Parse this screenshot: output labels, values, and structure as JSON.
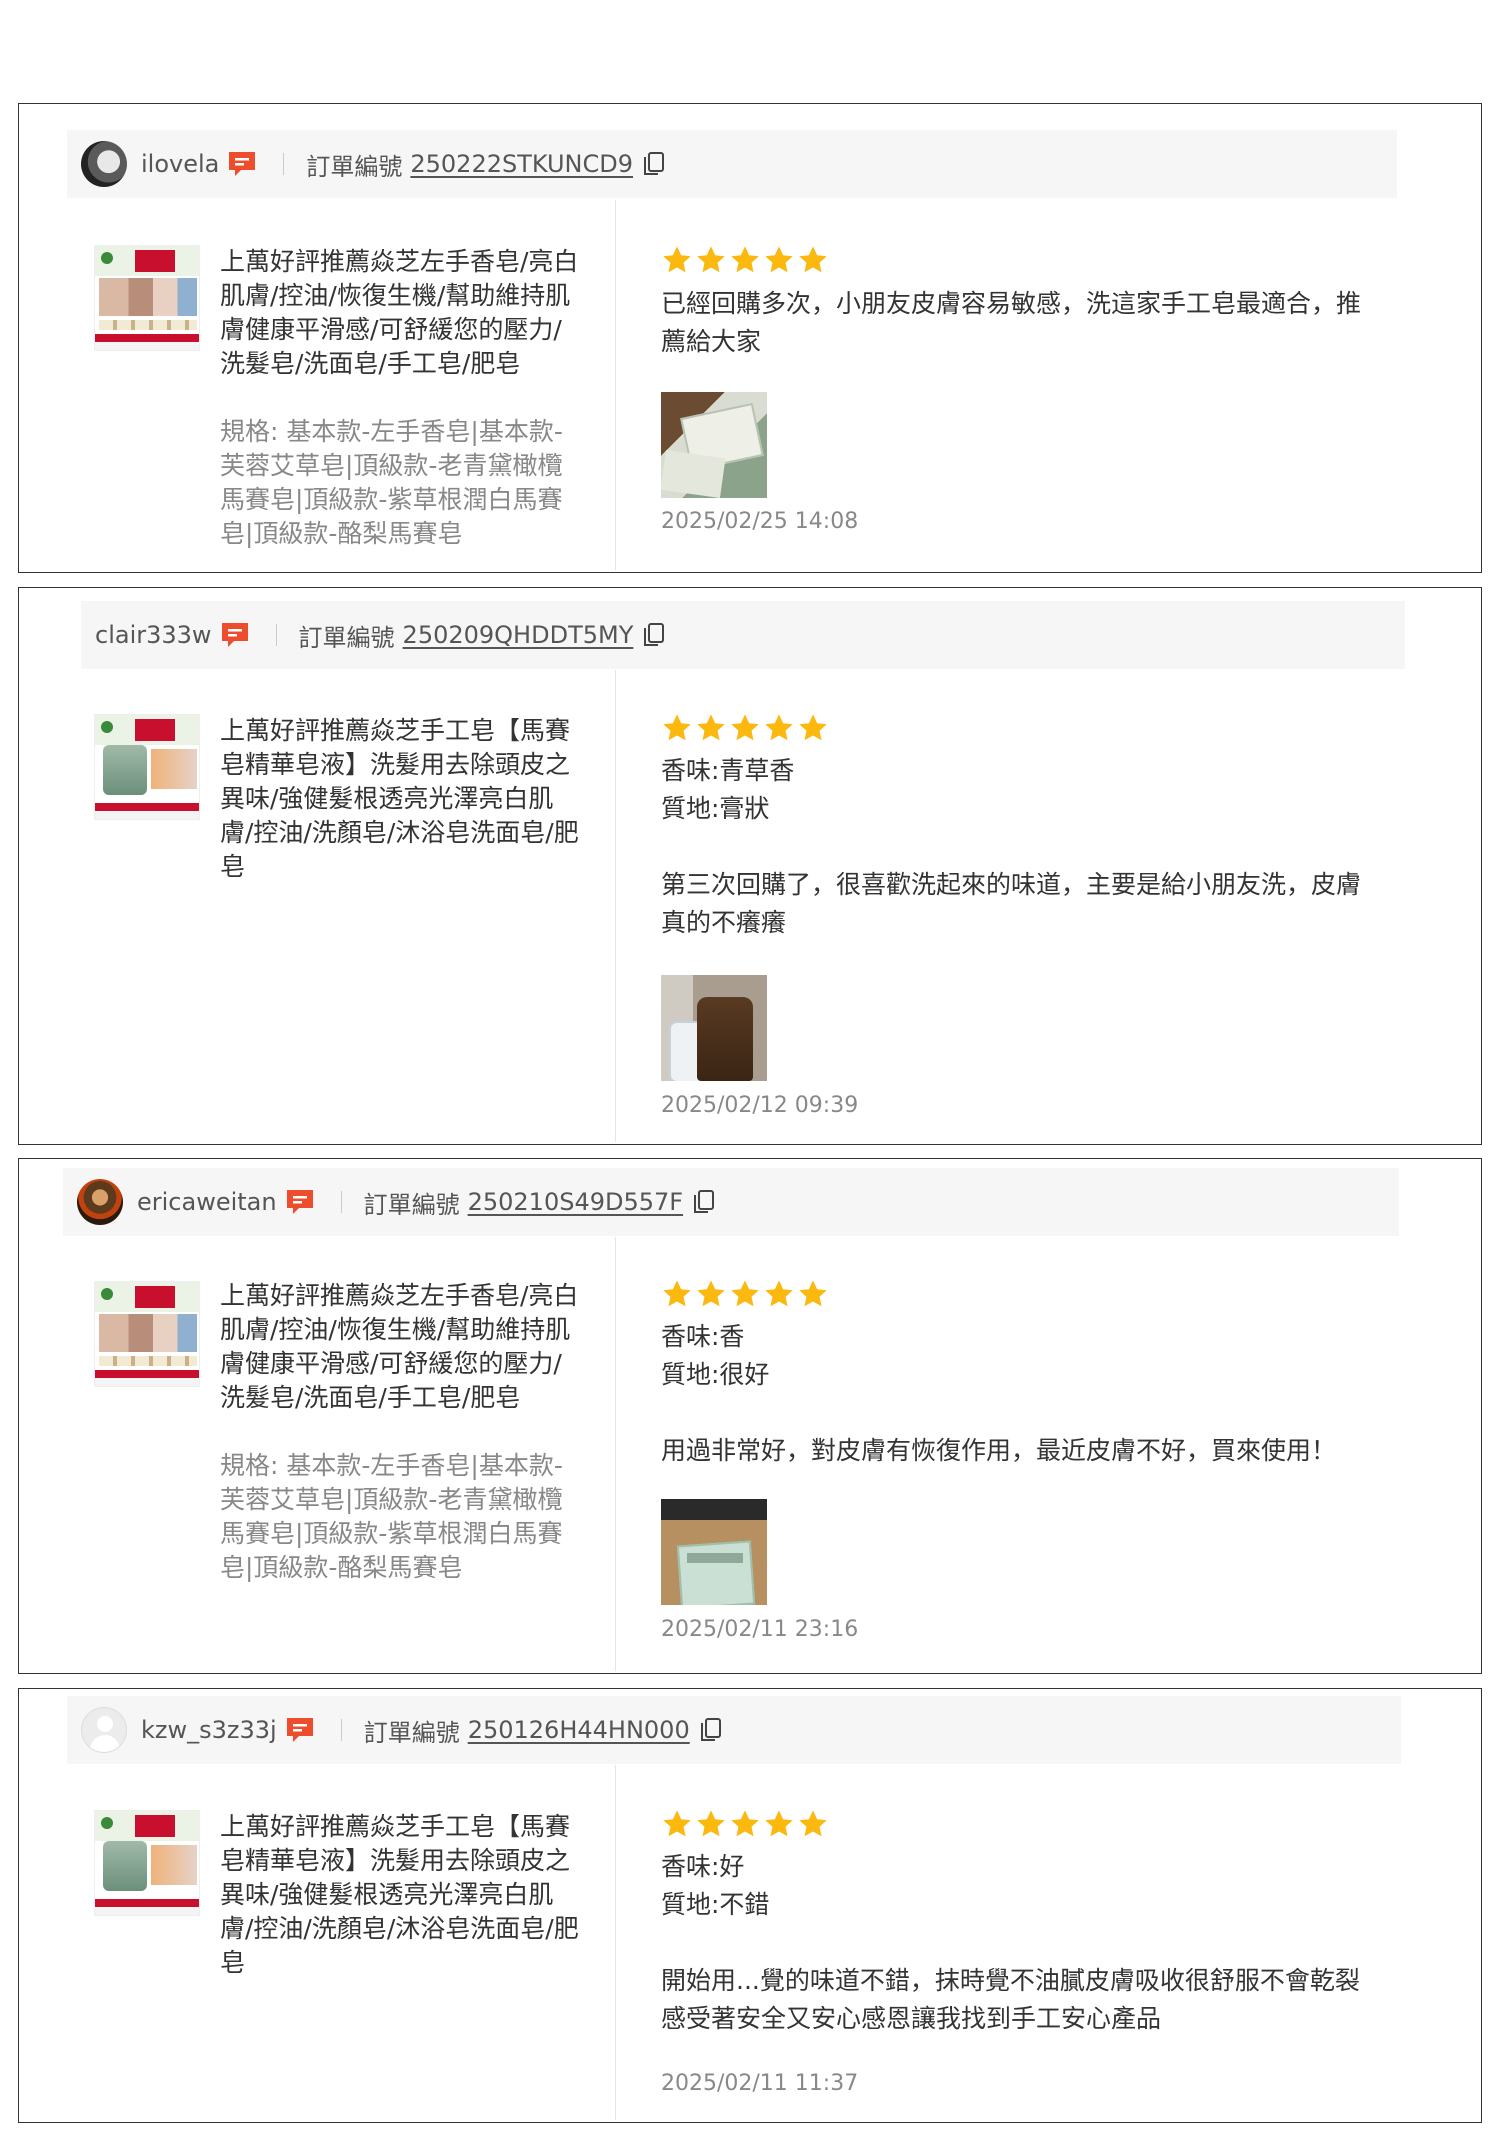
{
  "reviews": [
    {
      "username": "ilovela",
      "order_label": "訂單編號",
      "order_id": "250222STKUNCD9",
      "product_name": "上萬好評推薦焱芝左手香皂/亮白肌膚/控油/恢復生機/幫助維持肌膚健康平滑感/可舒緩您的壓力/洗髮皂/洗面皂/手工皂/肥皂",
      "spec": "規格: 基本款-左手香皂|基本款-芙蓉艾草皂|頂級款-老青黛橄欖馬賽皂|頂級款-紫草根潤白馬賽皂|頂級款-酪梨馬賽皂",
      "rating": 5,
      "review_text": "已經回購多次，小朋友皮膚容易敏感，洗這家手工皂最適合，推薦給大家",
      "date": "2025/02/25 14:08"
    },
    {
      "username": "clair333w",
      "order_label": "訂單編號",
      "order_id": "250209QHDDT5MY",
      "product_name": "上萬好評推薦焱芝手工皂【馬賽皂精華皂液】洗髮用去除頭皮之異味/強健髮根透亮光澤亮白肌膚/控油/洗顏皂/沐浴皂洗面皂/肥皂",
      "rating": 5,
      "scent": "香味:青草香",
      "texture": "質地:膏狀",
      "review_text": "第三次回購了，很喜歡洗起來的味道，主要是給小朋友洗，皮膚真的不癢癢",
      "date": "2025/02/12 09:39"
    },
    {
      "username": "ericaweitan",
      "order_label": "訂單編號",
      "order_id": "250210S49D557F",
      "product_name": "上萬好評推薦焱芝左手香皂/亮白肌膚/控油/恢復生機/幫助維持肌膚健康平滑感/可舒緩您的壓力/洗髮皂/洗面皂/手工皂/肥皂",
      "spec": "規格: 基本款-左手香皂|基本款-芙蓉艾草皂|頂級款-老青黛橄欖馬賽皂|頂級款-紫草根潤白馬賽皂|頂級款-酪梨馬賽皂",
      "rating": 5,
      "scent": "香味:香",
      "texture": "質地:很好",
      "review_text": "用過非常好，對皮膚有恢復作用，最近皮膚不好，買來使用！",
      "date": "2025/02/11 23:16"
    },
    {
      "username": "kzw_s3z33j",
      "order_label": "訂單編號",
      "order_id": "250126H44HN000",
      "product_name": "上萬好評推薦焱芝手工皂【馬賽皂精華皂液】洗髮用去除頭皮之異味/強健髮根透亮光澤亮白肌膚/控油/洗顏皂/沐浴皂洗面皂/肥皂",
      "rating": 5,
      "scent": "香味:好",
      "texture": "質地:不錯",
      "review_text": "開始用...覺的味道不錯，抹時覺不油膩皮膚吸收很舒服不會乾裂感受著安全又安心感恩讓我找到手工安心產品",
      "date": "2025/02/11 11:37"
    }
  ],
  "icons": {
    "chat": "chat-bubble-icon",
    "copy": "copy-icon",
    "star": "star-icon"
  },
  "colors": {
    "star": "#fbb80f",
    "chat": "#ee4d2d",
    "border": "#333333",
    "header_bg": "#f6f6f6"
  }
}
